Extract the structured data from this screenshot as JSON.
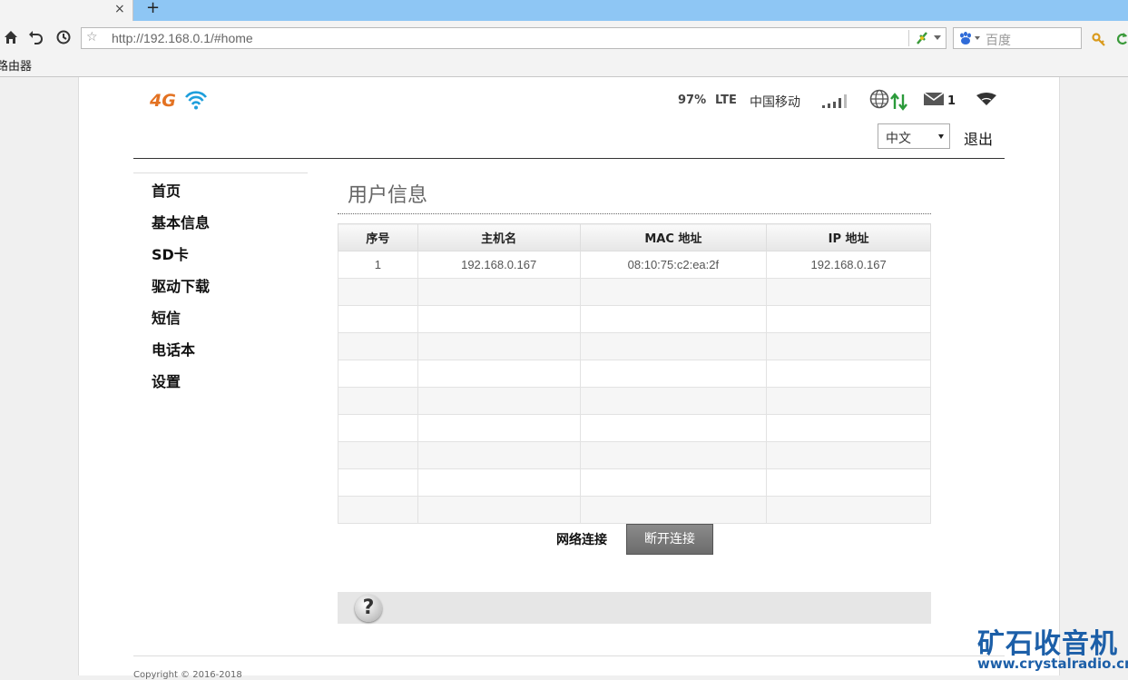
{
  "browser": {
    "tab_close": "×",
    "new_tab": "+",
    "url": "http://192.168.0.1/#home",
    "search_placeholder": "百度",
    "bookmark": "路由器"
  },
  "header": {
    "battery": "97%",
    "network_type": "LTE",
    "carrier": "中国移动",
    "sms_count": "1",
    "language": "中文",
    "logout": "退出"
  },
  "sidebar": {
    "items": [
      {
        "label": "首页"
      },
      {
        "label": "基本信息"
      },
      {
        "label": "SD卡"
      },
      {
        "label": "驱动下载"
      },
      {
        "label": "短信"
      },
      {
        "label": "电话本"
      },
      {
        "label": "设置"
      }
    ]
  },
  "main": {
    "title": "用户信息",
    "table": {
      "headers": [
        "序号",
        "主机名",
        "MAC 地址",
        "IP 地址"
      ],
      "rows": [
        [
          "1",
          "192.168.0.167",
          "08:10:75:c2:ea:2f",
          "192.168.0.167"
        ]
      ],
      "empty_rows": 9
    },
    "network_label": "网络连接",
    "disconnect_button": "断开连接",
    "help": "?"
  },
  "footer": {
    "copyright": "Copyright © 2016-2018"
  },
  "watermark": {
    "cn": "矿石收音机",
    "en": "www.crystalradio.cn"
  },
  "colors": {
    "tabbar": "#8ec6f4",
    "logo_orange": "#e37222",
    "logo_blue": "#1e9fdc",
    "watermark_blue": "#1c5fa8"
  }
}
